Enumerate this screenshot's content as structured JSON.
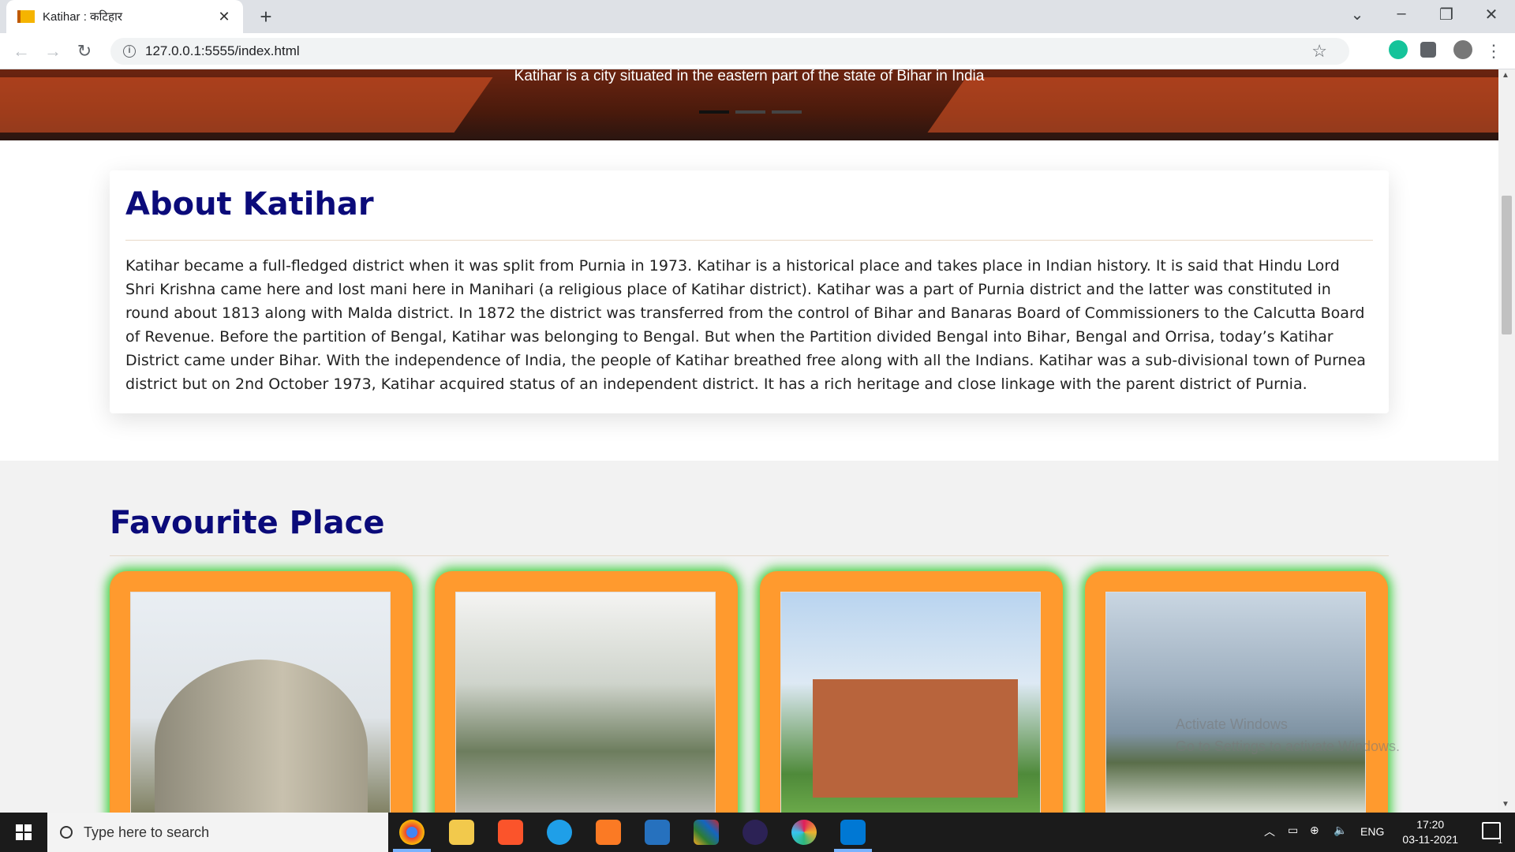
{
  "browser": {
    "tab_title": "Katihar : कटिहार",
    "url": "127.0.0.1:5555/index.html"
  },
  "hero": {
    "caption": "Katihar is a city situated in the eastern part of the state of Bihar in India"
  },
  "about": {
    "title": "About Katihar",
    "body": "Katihar became a full-fledged district when it was split from Purnia in 1973. Katihar is a historical place and takes place in Indian history. It is said that Hindu Lord Shri Krishna came here and lost mani here in Manihari (a religious place of Katihar district). Katihar was a part of Purnia district and the latter was constituted in round about 1813 along with Malda district. In 1872 the district was transferred from the control of Bihar and Banaras Board of Commissioners to the Calcutta Board of Revenue. Before the partition of Bengal, Katihar was belonging to Bengal. But when the Partition divided Bengal into Bihar, Bengal and Orrisa, today’s Katihar District came under Bihar. With the independence of India, the people of Katihar breathed free along with all the Indians. Katihar was a sub-divisional town of Purnea district but on 2nd October 1973, Katihar acquired status of an independent district. It has a rich heritage and close linkage with the parent district of Purnia."
  },
  "favourites": {
    "title": "Favourite Place",
    "card_border_color": "#ff9a2e",
    "card_glow_color": "#3fcf3f"
  },
  "watermark": {
    "line1": "Activate Windows",
    "line2": "Go to Settings to activate Windows."
  },
  "taskbar": {
    "search_placeholder": "Type here to search",
    "language": "ENG",
    "time": "17:20",
    "date": "03-11-2021",
    "notification_count": "1"
  },
  "colors": {
    "heading": "#0b0b7a",
    "accent_orange": "#ff9a2e"
  }
}
